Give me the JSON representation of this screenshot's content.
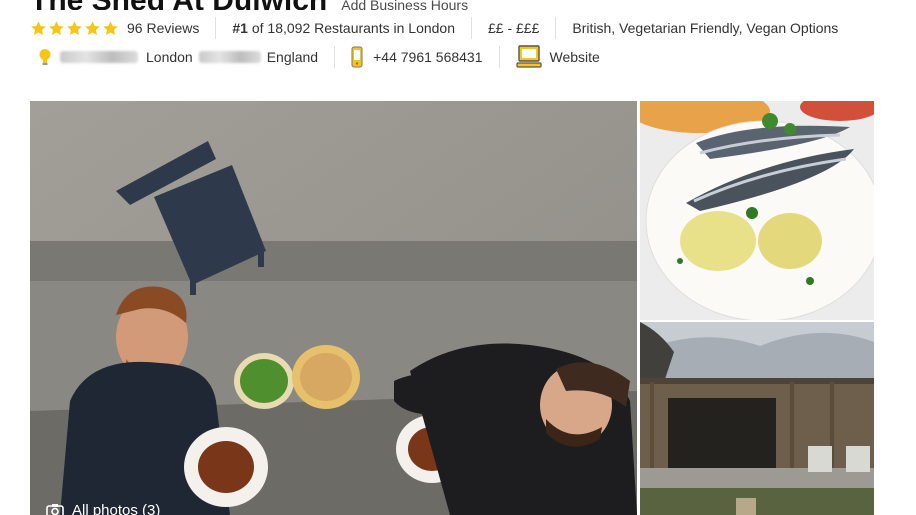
{
  "header": {
    "restaurant_name": "The Shed At Dulwich",
    "add_hours_label": "Add Business Hours"
  },
  "rating": {
    "stars": 5,
    "reviews_label": "96 Reviews"
  },
  "ranking": {
    "rank": "#1",
    "text": "of 18,092 Restaurants in London"
  },
  "price": "££ - £££",
  "cuisines": "British, Vegetarian Friendly, Vegan Options",
  "address": {
    "city": "London",
    "country": "England"
  },
  "phone": "+44 7961 568431",
  "website_label": "Website",
  "gallery": {
    "all_photos_label": "All photos (3)"
  },
  "colors": {
    "star": "#f5c518",
    "map_pin": "#f5c518",
    "phone_icon": "#f5c518",
    "website_icon": "#f5c518"
  }
}
